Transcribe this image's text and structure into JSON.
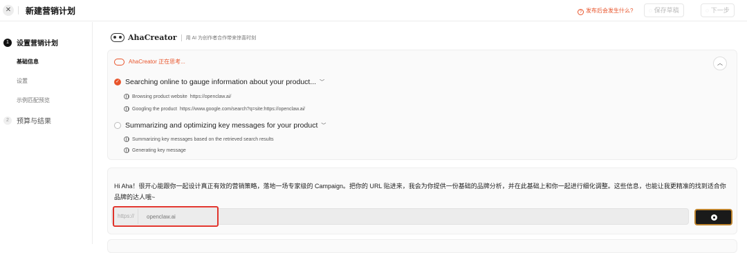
{
  "header": {
    "close_icon": "close-icon",
    "title": "新建营销计划",
    "help_text": "发布后会发生什么?",
    "save_draft_label": "保存草稿",
    "next_label": "下一步"
  },
  "sidebar": {
    "steps": [
      {
        "num": "1",
        "label": "设置营销计划",
        "sub": [
          "基础信息",
          "设置",
          "示例匹配预览"
        ]
      },
      {
        "num": "2",
        "label": "预算与结果"
      }
    ]
  },
  "brand": {
    "name": "AhaCreator",
    "tagline": "用 AI 为创作者合作带来惊喜时刻"
  },
  "thinking": {
    "header": "AhaCreator 正在思考...",
    "tasks": [
      {
        "title": "Searching online to gauge information about your product...",
        "status": "done",
        "steps": [
          {
            "text": "Browsing product website",
            "url": "https://openclaw.ai/"
          },
          {
            "text": "Googling the product",
            "url": "https://www.google.com/search?q=site:https://openclaw.ai/"
          }
        ]
      },
      {
        "title": "Summarizing and optimizing key messages for your product",
        "status": "pending",
        "steps": [
          {
            "text": "Summarizing key messages based on the retrieved search results",
            "url": ""
          },
          {
            "text": "Generating key message",
            "url": ""
          }
        ]
      }
    ]
  },
  "message": {
    "text": "Hi Aha！很开心能跟你一起设计真正有效的营销策略，落地一场专家级的 Campaign。把你的 URL 贴进来，我会为你提供一份基础的品牌分析，并在此基础上和你一起进行细化调整。这些信息，也能让我更精准的找到适合你品牌的达人哦~",
    "url_prefix": "https://",
    "url_placeholder": "openclaw.ai"
  },
  "colors": {
    "accent": "#e8542b",
    "highlight": "#e0322a"
  }
}
